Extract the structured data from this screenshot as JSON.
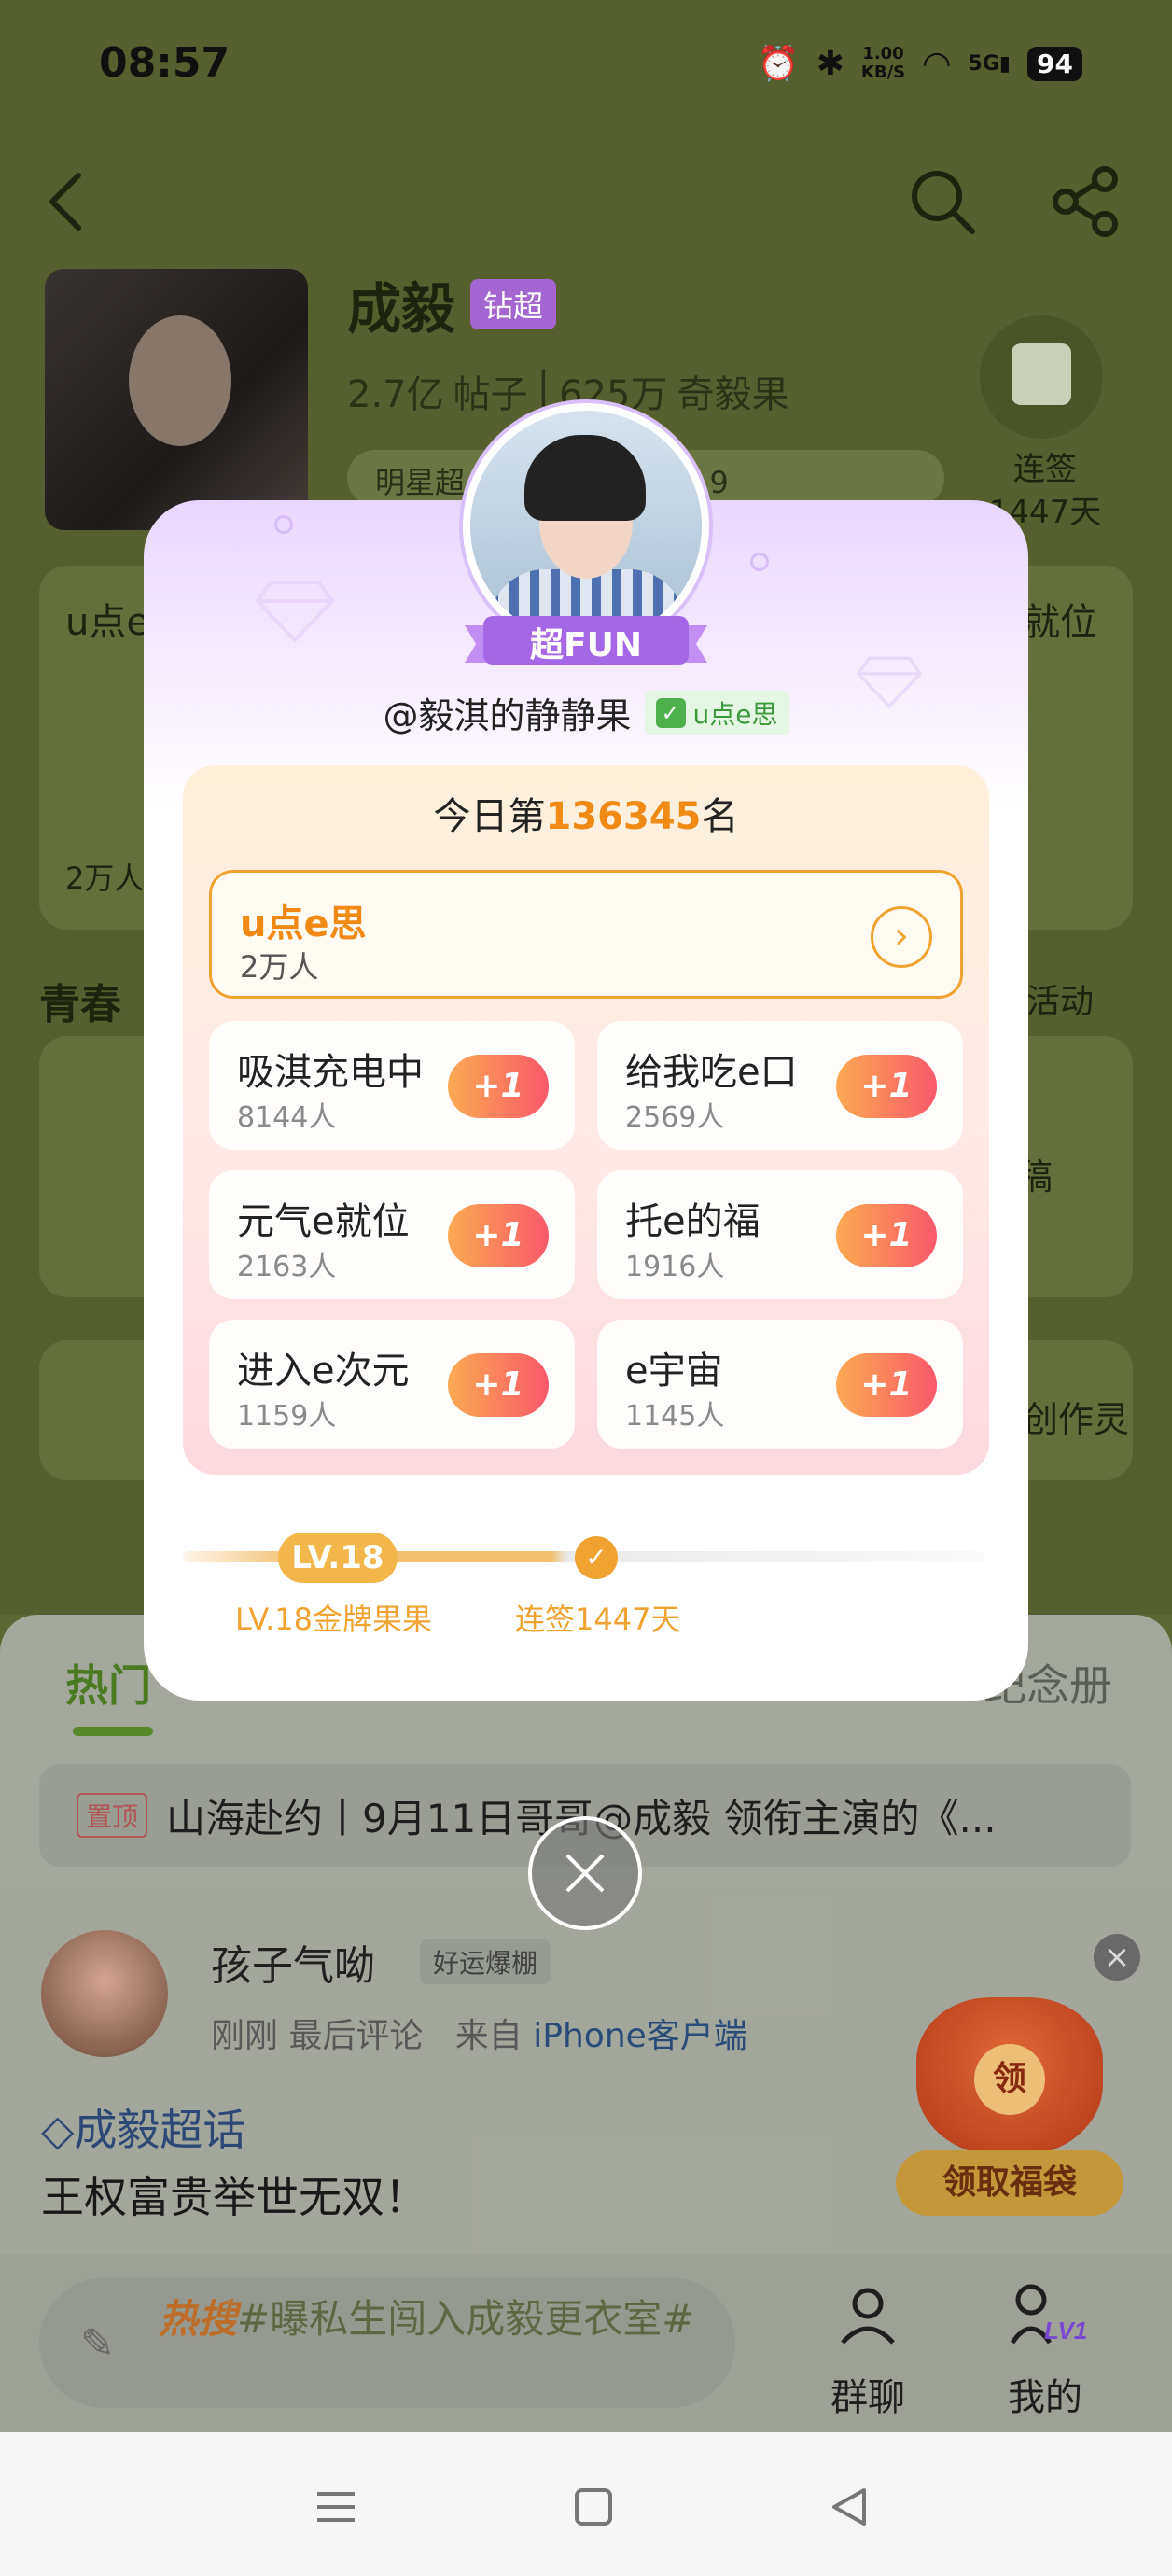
{
  "status_bar": {
    "time": "08:57",
    "speed_value": "1.00",
    "speed_unit": "KB/S",
    "network": "5G",
    "battery": "94"
  },
  "header": {
    "name": "成毅",
    "badge": "钻超",
    "posts_count": "2.7亿",
    "posts_label": "帖子",
    "fans_count": "625万",
    "fans_label": "奇毅果",
    "rank_text": "明星超…到13.6万人 No.9",
    "checkin_label": "连签",
    "checkin_days": "1447天"
  },
  "background": {
    "card1_left": "u点e",
    "card1_right": "就位",
    "card1_count": "2万人",
    "section_left": "青春",
    "section_right": "活动",
    "draft_btn": "稿",
    "creative": "创作灵"
  },
  "popup": {
    "title_badge": "超FUN",
    "username": "@毅淇的静静果",
    "group_badge": "u点e思",
    "rank_prefix": "今日第",
    "rank_number": "136345",
    "rank_suffix": "名",
    "main_group": {
      "name": "u点e思",
      "count": "2万人"
    },
    "groups": [
      {
        "name": "吸淇充电中",
        "count": "8144人",
        "action": "+1"
      },
      {
        "name": "给我吃e口",
        "count": "2569人",
        "action": "+1"
      },
      {
        "name": "元气e就位",
        "count": "2163人",
        "action": "+1"
      },
      {
        "name": "托e的福",
        "count": "1916人",
        "action": "+1"
      },
      {
        "name": "进入e次元",
        "count": "1159人",
        "action": "+1"
      },
      {
        "name": "e宇宙",
        "count": "1145人",
        "action": "+1"
      }
    ],
    "level_badge": "LV.18",
    "level_label": "LV.18金牌果果",
    "streak_label": "连签1447天",
    "level_progress": 0.48
  },
  "feed": {
    "tab_hot": "热门",
    "tab_album": "纪念册",
    "pinned_tag": "置顶",
    "pinned_text": "山海赴约丨9月11日哥哥@成毅 领衔主演的《...",
    "post": {
      "user": "孩子气呦",
      "user_badge": "好运爆棚",
      "time": "刚刚 最后评论",
      "source_prefix": "来自",
      "source": "iPhone客户端",
      "topic": "成毅超话",
      "text": "王权富贵举世无双！"
    },
    "gift_seal": "领",
    "gift_button": "领取福袋"
  },
  "bottom_bar": {
    "hot_tag": "热搜",
    "hot_text": "#曝私生闯入成毅更衣室#",
    "group_chat": "群聊",
    "mine": "我的"
  },
  "colors": {
    "accent_orange": "#f08a14",
    "purple": "#a868d6",
    "plus_gradient_start": "#fcaa52",
    "plus_gradient_end": "#f9596a"
  }
}
